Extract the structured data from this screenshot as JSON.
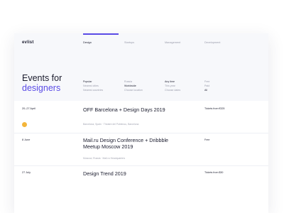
{
  "logo": {
    "text": "evlist"
  },
  "nav": [
    {
      "label": "Design"
    },
    {
      "label": "Startups"
    },
    {
      "label": "Management"
    },
    {
      "label": "Development"
    }
  ],
  "hero": {
    "line1": "Events for",
    "line2": "designers"
  },
  "filters": {
    "cities": [
      "Popular",
      "Nearest cities",
      "Nearest countries"
    ],
    "formats": [
      "Russia",
      "Worldwide",
      "Choose location"
    ],
    "dates": [
      "Any time",
      "This year",
      "Choose dates"
    ],
    "price": [
      "Free",
      "Paid",
      "All"
    ]
  },
  "events": [
    {
      "date": "20–27 April",
      "title": "OFF Barcelona + Design Days 2019",
      "meta": "Barcelona, Spain · Theatre del Poblenou, Barcelona",
      "price": "Tickets from €325"
    },
    {
      "date": "8 June",
      "title": "Mail.ru Design Conference + Dribbble Meetup Moscow 2019",
      "meta": "Moscow, Russia · Mail.ru Headquarters",
      "price": "Free"
    },
    {
      "date": "27 July",
      "title": "Design Trend 2019",
      "price": "Tickets from $30"
    }
  ],
  "colors": {
    "accent": "#5a4be6",
    "badge": "#f3b53a",
    "text": "#1b1c2e",
    "muted": "#9a9cab"
  }
}
